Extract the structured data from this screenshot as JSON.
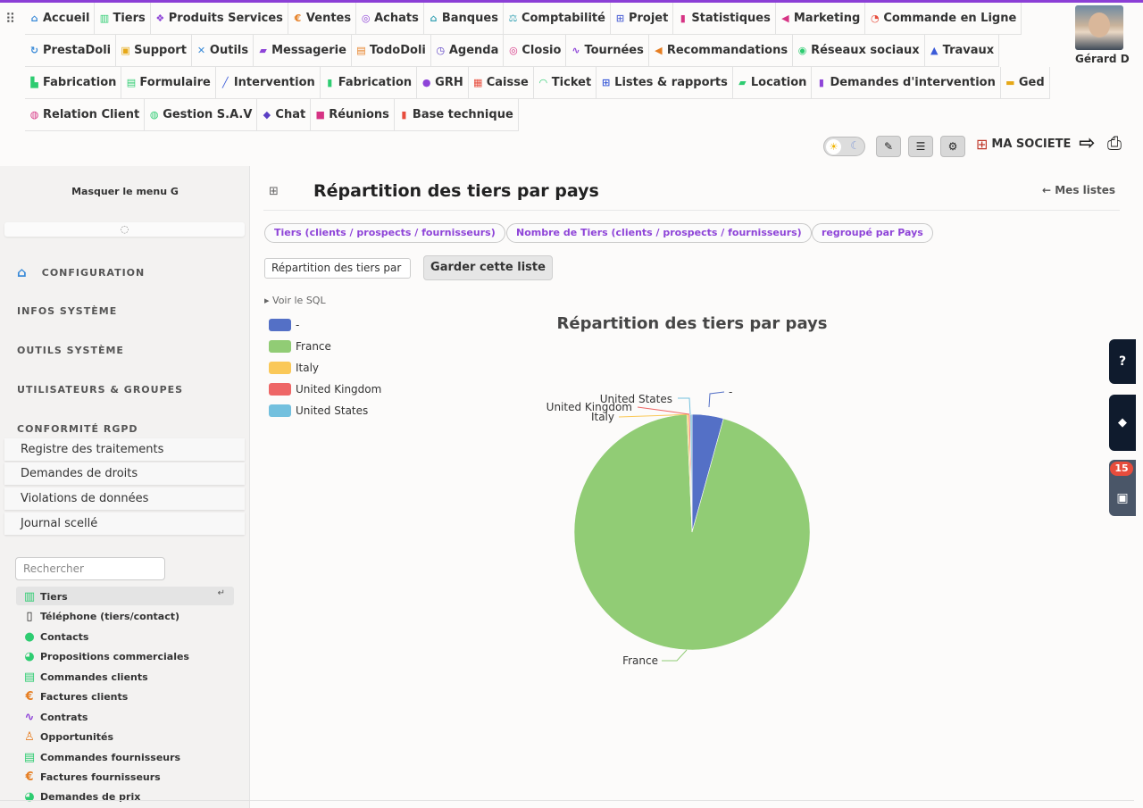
{
  "top_menu": {
    "rows": [
      [
        {
          "label": "Accueil",
          "icon": "home-icon",
          "glyph": "⌂",
          "color": "#3b8bd8"
        },
        {
          "label": "Tiers",
          "icon": "building-icon",
          "glyph": "▥",
          "color": "#2ecc71"
        },
        {
          "label": "Produits Services",
          "icon": "cubes-icon",
          "glyph": "❖",
          "color": "#8e44d8"
        },
        {
          "label": "Ventes",
          "icon": "euro-icon",
          "glyph": "€",
          "color": "#e67e22"
        },
        {
          "label": "Achats",
          "icon": "coins-icon",
          "glyph": "◎",
          "color": "#8e44d8"
        },
        {
          "label": "Banques",
          "icon": "bank-icon",
          "glyph": "⌂",
          "color": "#3aa3b5"
        },
        {
          "label": "Comptabilité",
          "icon": "balance-icon",
          "glyph": "⚖",
          "color": "#3aa3b5"
        },
        {
          "label": "Projet",
          "icon": "sitemap-icon",
          "glyph": "⊞",
          "color": "#5b6dd8"
        },
        {
          "label": "Statistiques",
          "icon": "chart-icon",
          "glyph": "▮",
          "color": "#d63384"
        },
        {
          "label": "Marketing",
          "icon": "bullhorn-icon",
          "glyph": "◀",
          "color": "#d63384"
        },
        {
          "label": "Commande en Ligne",
          "icon": "order-icon",
          "glyph": "◔",
          "color": "#e74c3c"
        }
      ],
      [
        {
          "label": "PrestaDoli",
          "icon": "sync-icon",
          "glyph": "↻",
          "color": "#3b8bd8"
        },
        {
          "label": "Support",
          "icon": "support-icon",
          "glyph": "▣",
          "color": "#e6a817"
        },
        {
          "label": "Outils",
          "icon": "tools-icon",
          "glyph": "✕",
          "color": "#3b8bd8"
        },
        {
          "label": "Messagerie",
          "icon": "truck-icon",
          "glyph": "▰",
          "color": "#8e44d8"
        },
        {
          "label": "TodoDoli",
          "icon": "calendar-check-icon",
          "glyph": "▤",
          "color": "#e67e22"
        },
        {
          "label": "Agenda",
          "icon": "clock-icon",
          "glyph": "◷",
          "color": "#5b3fc4"
        },
        {
          "label": "Closio",
          "icon": "target-icon",
          "glyph": "◎",
          "color": "#d63384"
        },
        {
          "label": "Tournées",
          "icon": "route-icon",
          "glyph": "∿",
          "color": "#8e44d8"
        },
        {
          "label": "Recommandations",
          "icon": "bullhorn-icon",
          "glyph": "◀",
          "color": "#e67e22"
        },
        {
          "label": "Réseaux sociaux",
          "icon": "broadcast-icon",
          "glyph": "◉",
          "color": "#2ecc71"
        },
        {
          "label": "Travaux",
          "icon": "road-icon",
          "glyph": "▲",
          "color": "#3b5bd8"
        }
      ],
      [
        {
          "label": "Fabrication",
          "icon": "industry-icon",
          "glyph": "▙",
          "color": "#2ecc71"
        },
        {
          "label": "Formulaire",
          "icon": "form-icon",
          "glyph": "▤",
          "color": "#2ecc71"
        },
        {
          "label": "Intervention",
          "icon": "wrench-icon",
          "glyph": "╱",
          "color": "#3b5bd8"
        },
        {
          "label": "Fabrication",
          "icon": "barrel-icon",
          "glyph": "▮",
          "color": "#2ecc71"
        },
        {
          "label": "GRH",
          "icon": "users-icon",
          "glyph": "●",
          "color": "#8e44d8"
        },
        {
          "label": "Caisse",
          "icon": "cash-register-icon",
          "glyph": "▦",
          "color": "#e74c3c"
        },
        {
          "label": "Ticket",
          "icon": "headset-icon",
          "glyph": "◠",
          "color": "#2ecc71"
        },
        {
          "label": "Listes & rapports",
          "icon": "table-icon",
          "glyph": "⊞",
          "color": "#3b5bd8"
        },
        {
          "label": "Location",
          "icon": "truck-icon",
          "glyph": "▰",
          "color": "#2ecc71"
        },
        {
          "label": "Demandes d'intervention",
          "icon": "file-icon",
          "glyph": "▮",
          "color": "#8e44d8"
        },
        {
          "label": "Ged",
          "icon": "folder-icon",
          "glyph": "▬",
          "color": "#e6a817"
        }
      ],
      [
        {
          "label": "Relation Client",
          "icon": "handshake-icon",
          "glyph": "◍",
          "color": "#d63384"
        },
        {
          "label": "Gestion S.A.V",
          "icon": "handshake-icon",
          "glyph": "◍",
          "color": "#2ecc71"
        },
        {
          "label": "Chat",
          "icon": "comments-icon",
          "glyph": "◆",
          "color": "#5b3fc4"
        },
        {
          "label": "Réunions",
          "icon": "video-icon",
          "glyph": "■",
          "color": "#d63384"
        },
        {
          "label": "Base technique",
          "icon": "book-icon",
          "glyph": "▮",
          "color": "#e74c3c"
        }
      ]
    ]
  },
  "user": {
    "name": "Gérard D"
  },
  "toolbar": {
    "company": "MA SOCIETE"
  },
  "sidebar": {
    "hide_menu": "Masquer le menu G",
    "sections": {
      "config": "CONFIGURATION",
      "infos": "INFOS SYSTÈME",
      "outils": "OUTILS SYSTÈME",
      "users": "UTILISATEURS & GROUPES",
      "rgpd": "CONFORMITÉ RGPD"
    },
    "rgpd_items": [
      "Registre des traitements",
      "Demandes de droits",
      "Violations de données",
      "Journal scellé"
    ],
    "search_placeholder": "Rechercher",
    "links": [
      {
        "label": "Tiers",
        "icon": "building-icon",
        "glyph": "▥",
        "color": "#2ecc71"
      },
      {
        "label": "Téléphone (tiers/contact)",
        "icon": "mobile-icon",
        "glyph": "▯",
        "color": "#222"
      },
      {
        "label": "Contacts",
        "icon": "users-icon",
        "glyph": "●",
        "color": "#2ecc71"
      },
      {
        "label": "Propositions commerciales",
        "icon": "proposal-icon",
        "glyph": "◕",
        "color": "#2ecc71"
      },
      {
        "label": "Commandes clients",
        "icon": "file-icon",
        "glyph": "▤",
        "color": "#2ecc71"
      },
      {
        "label": "Factures clients",
        "icon": "euro-icon",
        "glyph": "€",
        "color": "#e67e22"
      },
      {
        "label": "Contrats",
        "icon": "contract-icon",
        "glyph": "∿",
        "color": "#8e44d8"
      },
      {
        "label": "Opportunités",
        "icon": "person-icon",
        "glyph": "♙",
        "color": "#e67e22"
      },
      {
        "label": "Commandes fournisseurs",
        "icon": "file-icon",
        "glyph": "▤",
        "color": "#2ecc71"
      },
      {
        "label": "Factures fournisseurs",
        "icon": "euro-icon",
        "glyph": "€",
        "color": "#e67e22"
      },
      {
        "label": "Demandes de prix",
        "icon": "proposal-icon",
        "glyph": "◕",
        "color": "#2ecc71"
      }
    ]
  },
  "main": {
    "title": "Répartition des tiers par pays",
    "back_link": "← Mes listes",
    "chips": [
      "Tiers (clients / prospects / fournisseurs)",
      "Nombre de Tiers (clients / prospects / fournisseurs)",
      "regroupé par Pays"
    ],
    "name_input_value": "Répartition des tiers par",
    "keep_button": "Garder cette liste",
    "sql_toggle": "▸ Voir le SQL"
  },
  "right_tabs": {
    "calendar_badge": "15"
  },
  "chart_data": {
    "type": "pie",
    "title": "Répartition des tiers par pays",
    "legend_position": "top-left",
    "categories": [
      "-",
      "France",
      "Italy",
      "United Kingdom",
      "United States"
    ],
    "values": [
      4.3,
      95.0,
      0.25,
      0.2,
      0.25
    ],
    "colors": [
      "#5470c6",
      "#91cc75",
      "#fac858",
      "#ee6666",
      "#73c0de"
    ]
  }
}
